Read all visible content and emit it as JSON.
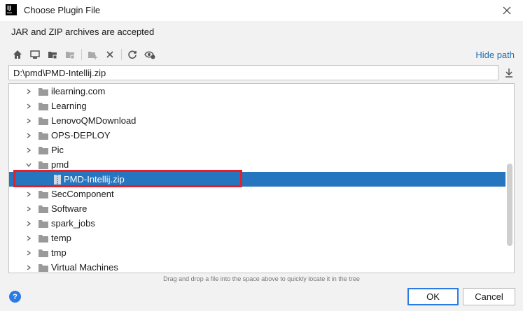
{
  "window": {
    "title": "Choose Plugin File",
    "logo_text": "IJ"
  },
  "description": "JAR and ZIP archives are accepted",
  "toolbar": {
    "buttons": [
      "home-icon",
      "desktop-icon",
      "project-folder-icon",
      "module-folder-icon",
      "new-folder-icon",
      "delete-icon",
      "refresh-icon",
      "show-hidden-icon"
    ],
    "hide_path_label": "Hide path"
  },
  "path_field": {
    "value": "D:\\pmd\\PMD-Intellij.zip"
  },
  "tree": {
    "items": [
      {
        "label": "ilearning.com",
        "type": "folder",
        "expanded": false
      },
      {
        "label": "Learning",
        "type": "folder",
        "expanded": false
      },
      {
        "label": "LenovoQMDownload",
        "type": "folder",
        "expanded": false
      },
      {
        "label": "OPS-DEPLOY",
        "type": "folder",
        "expanded": false
      },
      {
        "label": "Pic",
        "type": "folder",
        "expanded": false
      },
      {
        "label": "pmd",
        "type": "folder",
        "expanded": true
      },
      {
        "label": "PMD-Intellij.zip",
        "type": "zip",
        "selected": true
      },
      {
        "label": "SecComponent",
        "type": "folder",
        "expanded": false
      },
      {
        "label": "Software",
        "type": "folder",
        "expanded": false
      },
      {
        "label": "spark_jobs",
        "type": "folder",
        "expanded": false
      },
      {
        "label": "temp",
        "type": "folder",
        "expanded": false
      },
      {
        "label": "tmp",
        "type": "folder",
        "expanded": false
      },
      {
        "label": "Virtual Machines",
        "type": "folder",
        "expanded": false
      }
    ]
  },
  "hint": "Drag and drop a file into the space above to quickly locate it in the tree",
  "buttons": {
    "help": "?",
    "ok": "OK",
    "cancel": "Cancel"
  },
  "colors": {
    "selection": "#2675bf",
    "highlight_border": "#e0202a",
    "link": "#2470b3",
    "primary_border": "#2c7be5"
  }
}
